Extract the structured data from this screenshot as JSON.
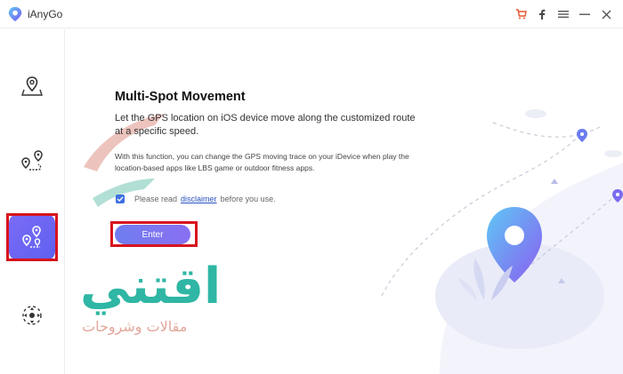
{
  "app": {
    "title": "iAnyGo"
  },
  "titlebar": {
    "icons": [
      "cart-icon",
      "facebook-icon",
      "menu-icon",
      "minimize-icon",
      "close-icon"
    ]
  },
  "sidebar": {
    "items": [
      {
        "name": "change-location",
        "icon": "map-pin-icon",
        "active": false
      },
      {
        "name": "two-spot-movement",
        "icon": "route-pins-icon",
        "active": false
      },
      {
        "name": "multi-spot-movement",
        "icon": "multi-pin-route-icon",
        "active": true
      },
      {
        "name": "joystick-movement",
        "icon": "joystick-icon",
        "active": false
      }
    ]
  },
  "main": {
    "heading": "Multi-Spot Movement",
    "description": "Let the GPS location on iOS device move along the customized route at a specific speed.",
    "detail": "With this function, you can change the GPS moving trace on your iDevice when play the location-based apps like LBS game or outdoor fitness apps.",
    "checkbox": {
      "checked": true,
      "prefix": "Please read",
      "link": "disclaimer",
      "suffix": "before you use."
    },
    "enter_label": "Enter"
  },
  "watermark": {
    "main": "اقتني",
    "sub": "مقالات وشروحات"
  },
  "colors": {
    "accent": "#6b6cf2",
    "highlight": "#d7141d",
    "watermark": "#2fb6a4"
  }
}
